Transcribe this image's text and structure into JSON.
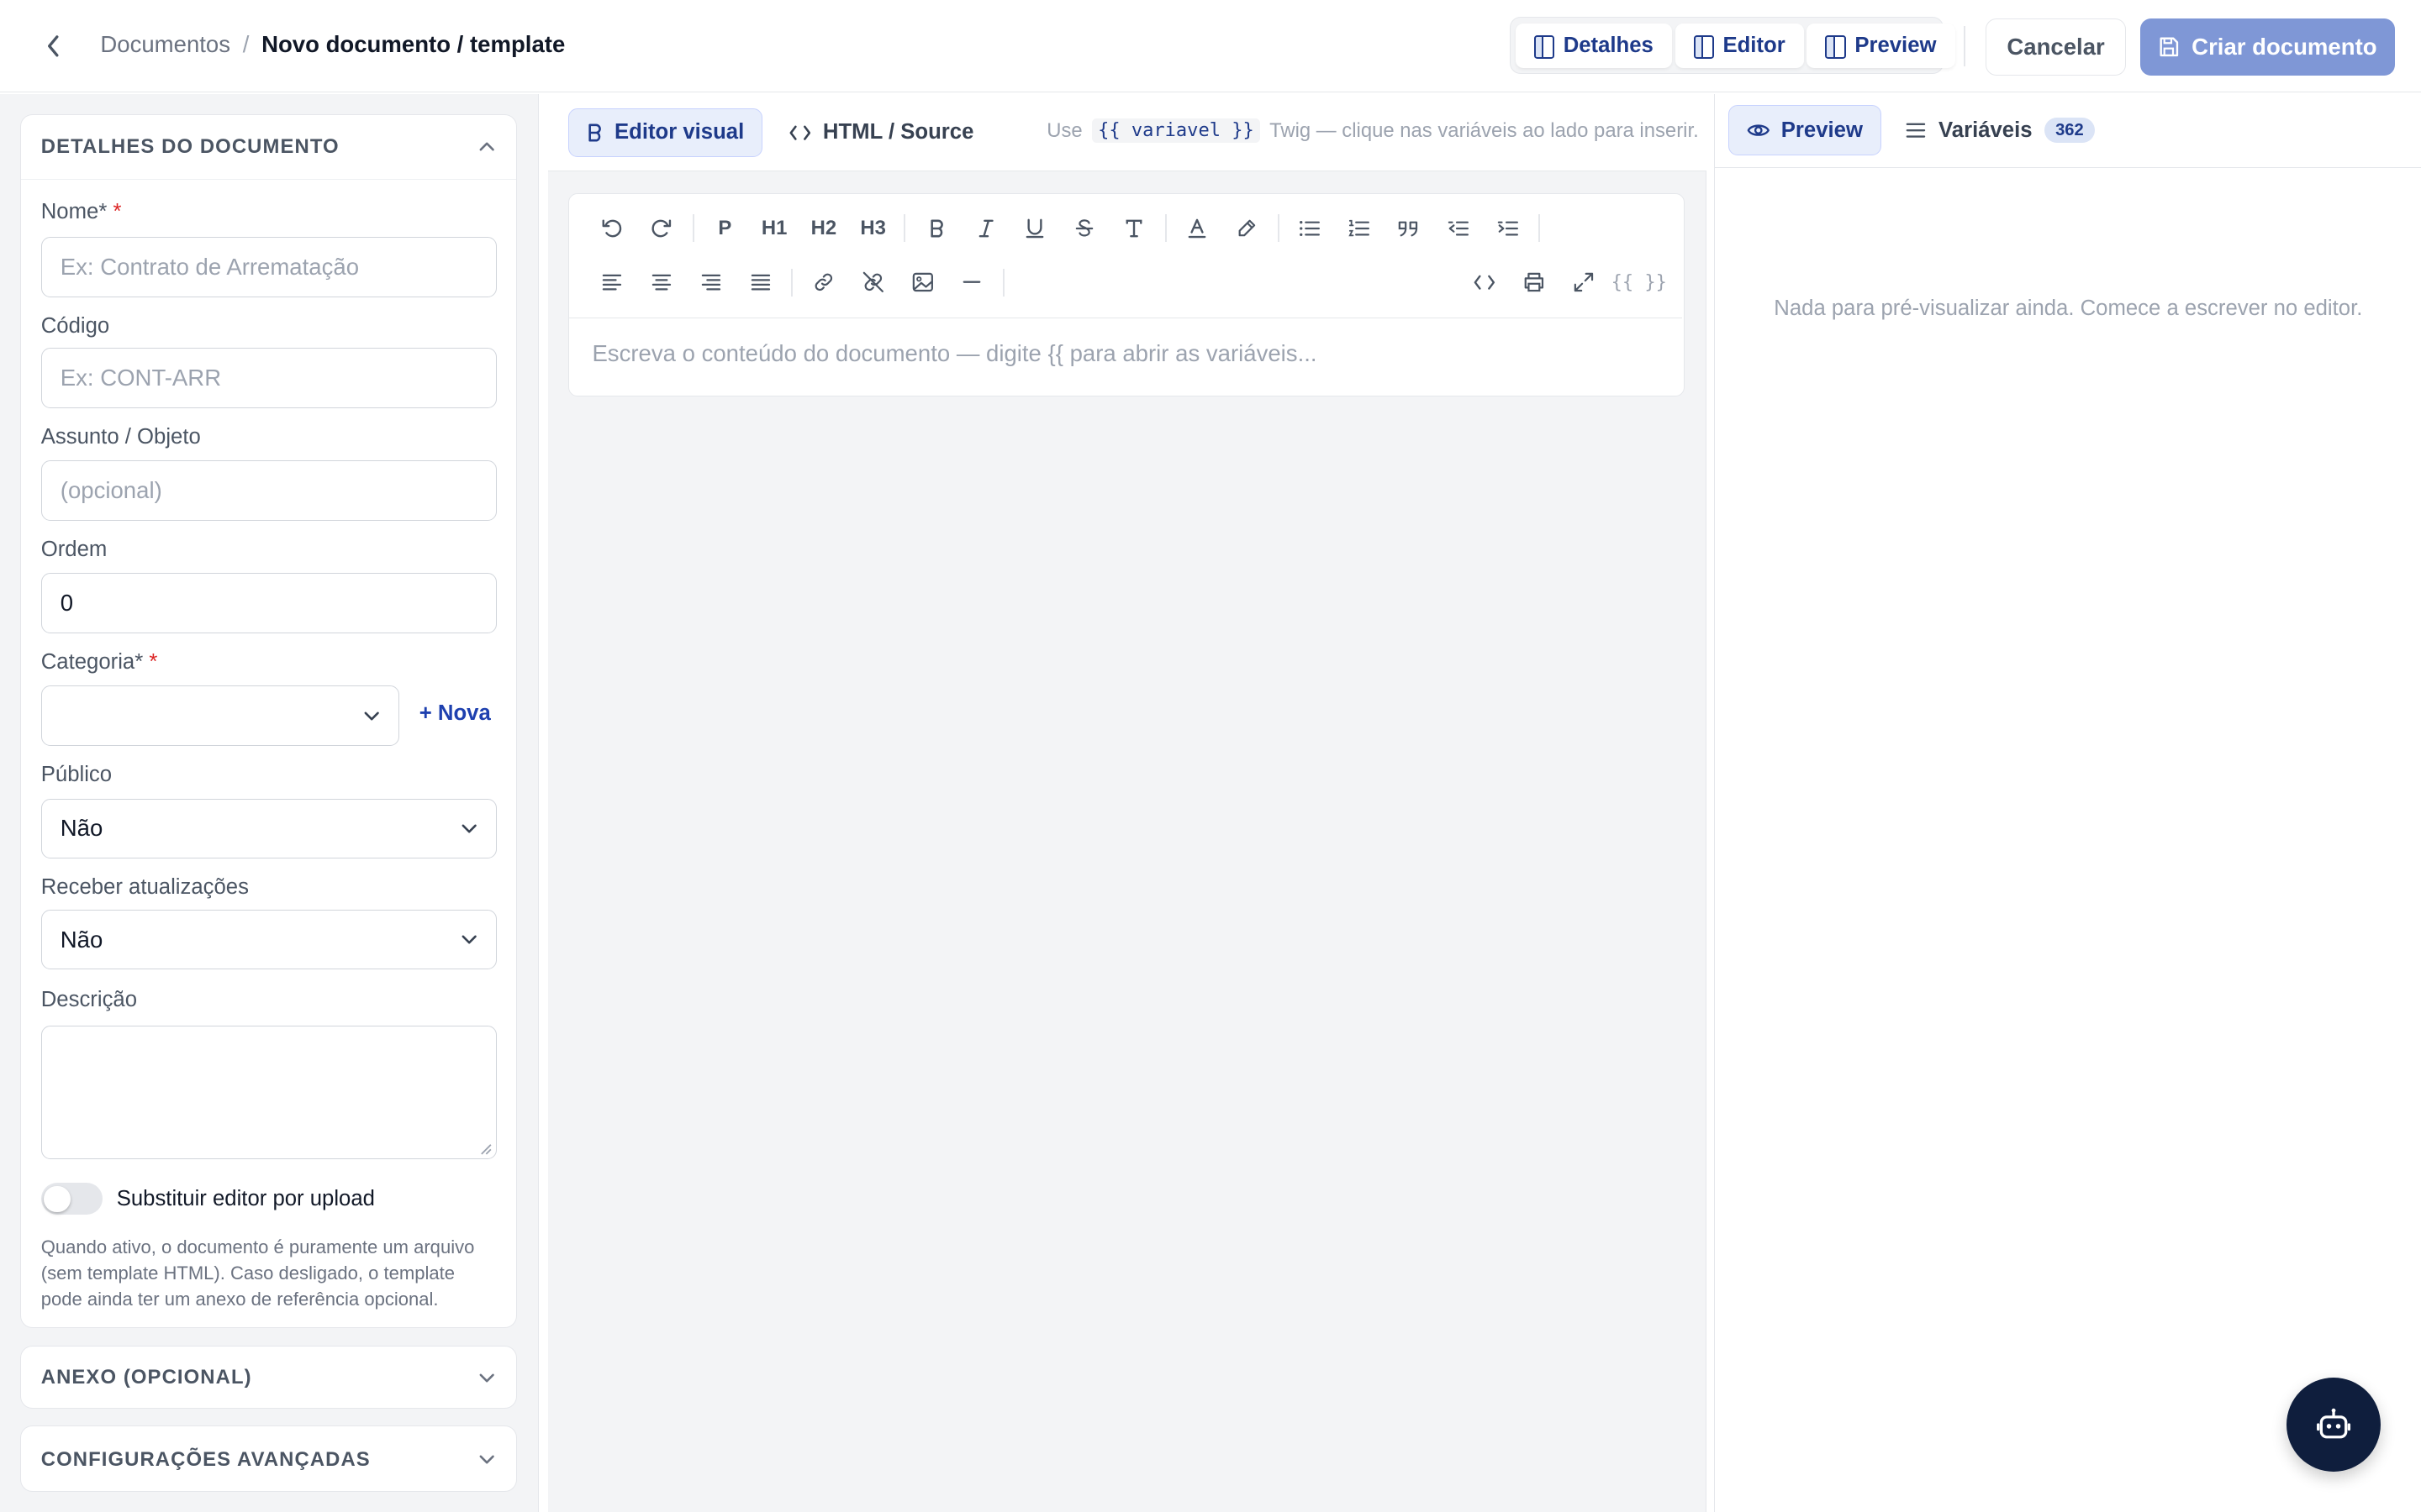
{
  "header": {
    "breadcrumb_parent": "Documentos",
    "breadcrumb_sep": "/",
    "breadcrumb_current": "Novo documento / template",
    "view_tabs": [
      {
        "label": "Detalhes"
      },
      {
        "label": "Editor"
      },
      {
        "label": "Preview"
      }
    ],
    "cancel_label": "Cancelar",
    "create_label": "Criar documento"
  },
  "details": {
    "section_title": "DETALHES DO DOCUMENTO",
    "nome_label": "Nome*",
    "nome_required": "*",
    "nome_placeholder": "Ex: Contrato de Arrematação",
    "codigo_label": "Código",
    "codigo_placeholder": "Ex: CONT-ARR",
    "assunto_label": "Assunto / Objeto",
    "assunto_placeholder": "(opcional)",
    "ordem_label": "Ordem",
    "ordem_value": "0",
    "categoria_label": "Categoria*",
    "categoria_required": "*",
    "categoria_value": "",
    "nova_label": "+ Nova",
    "publico_label": "Público",
    "publico_value": "Não",
    "receber_label": "Receber atualizações",
    "receber_value": "Não",
    "descricao_label": "Descrição",
    "toggle_label": "Substituir editor por upload",
    "toggle_on": false,
    "help_text": "Quando ativo, o documento é puramente um arquivo (sem template HTML). Caso desligado, o template pode ainda ter um anexo de referência opcional."
  },
  "sections": {
    "anexo": "ANEXO (OPCIONAL)",
    "config": "CONFIGURAÇÕES AVANÇADAS"
  },
  "editor": {
    "tab_visual": "Editor visual",
    "tab_html": "HTML / Source",
    "hint_prefix": "Use",
    "hint_code": "{{ variavel }}",
    "hint_suffix": "Twig — clique nas variáveis ao lado para inserir.",
    "toolbar_p": "P",
    "toolbar_h1": "H1",
    "toolbar_h2": "H2",
    "toolbar_h3": "H3",
    "toolbar_vars": "{{ }}",
    "placeholder": "Escreva o conteúdo do documento — digite {{ para abrir as variáveis..."
  },
  "preview": {
    "tab_preview": "Preview",
    "tab_variables": "Variáveis",
    "variables_count": "362",
    "empty_message": "Nada para pré-visualizar ainda. Comece a escrever no editor."
  },
  "colors": {
    "accent": "#1e3a8a",
    "primary_button": "#7f97d6",
    "required": "#dc2626",
    "bot_button": "#0f1e3d"
  }
}
